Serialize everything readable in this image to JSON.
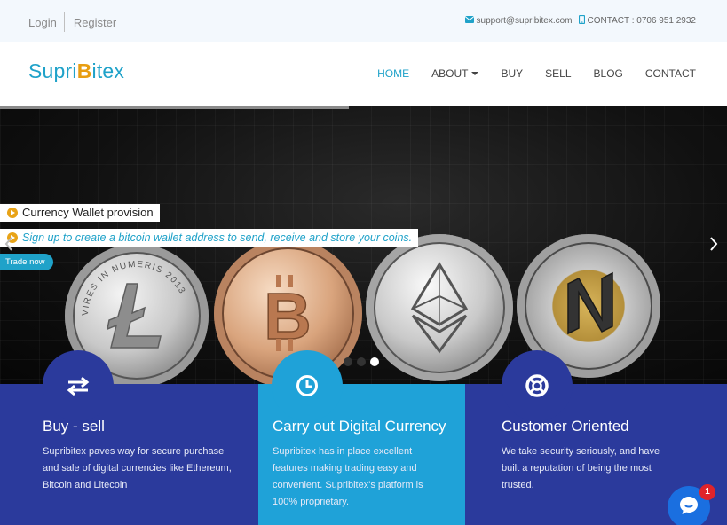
{
  "topbar": {
    "login": "Login",
    "register": "Register",
    "email": "support@supribitex.com",
    "contact": "CONTACT : 0706 951 2932"
  },
  "logo": {
    "prefix": "Supri",
    "mark": "B",
    "suffix": "itex"
  },
  "menu": [
    {
      "label": "HOME",
      "active": true
    },
    {
      "label": "ABOUT",
      "dropdown": true
    },
    {
      "label": "BUY"
    },
    {
      "label": "SELL"
    },
    {
      "label": "BLOG"
    },
    {
      "label": "CONTACT"
    }
  ],
  "hero": {
    "title": "Currency Wallet provision",
    "text": "Sign up to create a bitcoin wallet address to send, receive and store your coins.",
    "button": "Trade now",
    "slide_progress": 0.48,
    "coins": [
      "litecoin",
      "bitcoin",
      "ethereum",
      "nem"
    ],
    "litecoin_rim": "VIRES IN NUMERIS 2013"
  },
  "features": [
    {
      "icon": "exchange-icon",
      "title": "Buy - sell",
      "text": "Supribitex paves way for secure purchase and sale of digital currencies like Ethereum, Bitcoin and Litecoin"
    },
    {
      "icon": "clock-icon",
      "title": "Carry out Digital Currency",
      "text": "Supribitex has in place excellent features making trading easy and convenient. Supribitex's platform is 100% proprietary."
    },
    {
      "icon": "lifebuoy-icon",
      "title": "Customer Oriented",
      "text": "We take security seriously, and have built a reputation of being the most trusted."
    }
  ],
  "chat": {
    "badge": "1"
  },
  "colors": {
    "accent": "#1fa2c9",
    "navy": "#2b3a9c",
    "sky": "#1fa2d8",
    "bitcoin": "#e89e12"
  }
}
